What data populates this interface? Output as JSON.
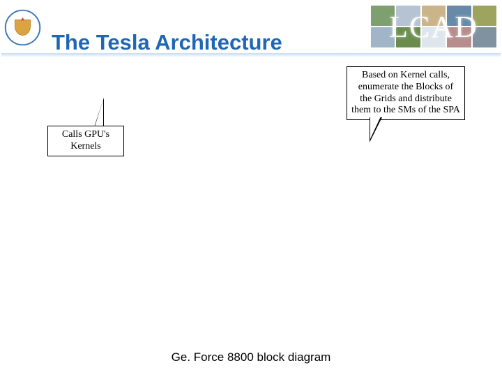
{
  "title": "The Tesla Architecture",
  "lcad": "LCAD",
  "callouts": {
    "left": "Calls GPU's Kernels",
    "right": "Based on Kernel calls, enumerate the Blocks of the Grids and distribute them to the SMs of the SPA"
  },
  "caption": "Ge. Force 8800 block diagram"
}
